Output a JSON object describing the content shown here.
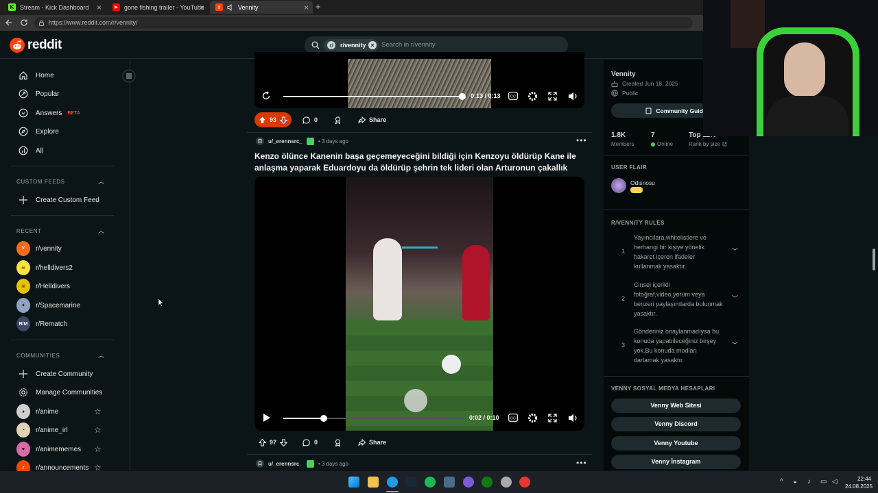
{
  "browser": {
    "tabs": [
      {
        "title": "Stream - Kick Dashboard",
        "favicon_color": "#53fc18",
        "favicon_letter": "K"
      },
      {
        "title": "gone fishing trailer - YouTube",
        "favicon_color": "#ff0000",
        "favicon_letter": "▶"
      },
      {
        "title": "Vennity",
        "favicon_color": "#ff4500",
        "favicon_letter": "r"
      }
    ],
    "url": "https://www.reddit.com/r/vennity/",
    "new_tab": "+"
  },
  "header": {
    "logo_text": "reddit",
    "search_chip": "r/vennity",
    "search_placeholder": "Search in r/vennity"
  },
  "sidebar": {
    "primary": [
      {
        "label": "Home",
        "icon": "home-icon"
      },
      {
        "label": "Popular",
        "icon": "popular-icon"
      },
      {
        "label": "Answers",
        "icon": "answers-icon",
        "badge": "BETA"
      },
      {
        "label": "Explore",
        "icon": "explore-icon"
      },
      {
        "label": "All",
        "icon": "all-icon"
      }
    ],
    "custom_feeds_header": "CUSTOM FEEDS",
    "create_custom_feed": "Create Custom Feed",
    "recent_header": "RECENT",
    "recent": [
      {
        "label": "r/vennity",
        "color": "#f26d21"
      },
      {
        "label": "r/helldivers2",
        "color": "#f6e33e"
      },
      {
        "label": "r/Helldivers",
        "color": "#e6c200"
      },
      {
        "label": "r/Spacemarine",
        "color": "#8fa3c0"
      },
      {
        "label": "r/Rematch",
        "color": "#3c4a66"
      }
    ],
    "communities_header": "COMMUNITIES",
    "create_community": "Create Community",
    "manage_communities": "Manage Communities",
    "communities": [
      {
        "label": "r/anime",
        "color": "#cfcfcf"
      },
      {
        "label": "r/anime_irl",
        "color": "#e0d2b4"
      },
      {
        "label": "r/animememes",
        "color": "#d86aa5"
      },
      {
        "label": "r/announcements",
        "color": "#ff4500"
      }
    ]
  },
  "feed": {
    "post1": {
      "time": "0:13 / 0:13",
      "progress": 1.0,
      "upvotes": "93",
      "comments": "0",
      "share": "Share"
    },
    "post2": {
      "user": "u/_erennsrc_",
      "age": "• 3 days ago",
      "title": "Kenzo ölünce Kanenin başa geçemeyeceğini bildiği için Kenzoyu öldürüp Kane ile anlaşma yaparak Eduardoyu da öldürüp şehrin tek lideri olan Arturonun çakallık",
      "time": "0:02 / 0:10",
      "progress": 0.2,
      "upvotes": "97",
      "comments": "0",
      "share": "Share"
    },
    "post3": {
      "user": "u/_erennsrc_",
      "age": "• 3 days ago"
    }
  },
  "right": {
    "name": "Vennity",
    "created": "Created Jun 18, 2025",
    "visibility": "Public",
    "guide_button": "Community Guide",
    "stats": [
      {
        "value": "1.8K",
        "label": "Members"
      },
      {
        "value": "7",
        "label": "Online"
      },
      {
        "value": "Top 11%",
        "label": "Rank by size"
      }
    ],
    "user_flair_header": "USER FLAIR",
    "flair_user": "Odisnosu",
    "rules_header": "R/VENNITY RULES",
    "rules": [
      {
        "num": "1",
        "text": "Yayıncılara,whitelistlere ve herhangi bir kişiye yönelik hakaret içeren ifadeler kullanmak yasaktır."
      },
      {
        "num": "2",
        "text": "Cinsel içerikli fotoğraf,video,yorum veya benzeri paylaşımlarda bulunmak yasaktır."
      },
      {
        "num": "3",
        "text": "Gönderiniz onaylanmadıysa bu konuda yapabileceğiniz birşey yok.Bu konuda modları darlamak yasaktır."
      }
    ],
    "social_header": "VENNY SOSYAL MEDYA HESAPLARI",
    "social_buttons": [
      "Venny Web Sitesi",
      "Venny Discord",
      "Venny Youtube",
      "Venny İnstagram"
    ]
  },
  "taskbar": {
    "time": "22:44",
    "date": "24.08.2025",
    "tray_chevron": "^"
  }
}
